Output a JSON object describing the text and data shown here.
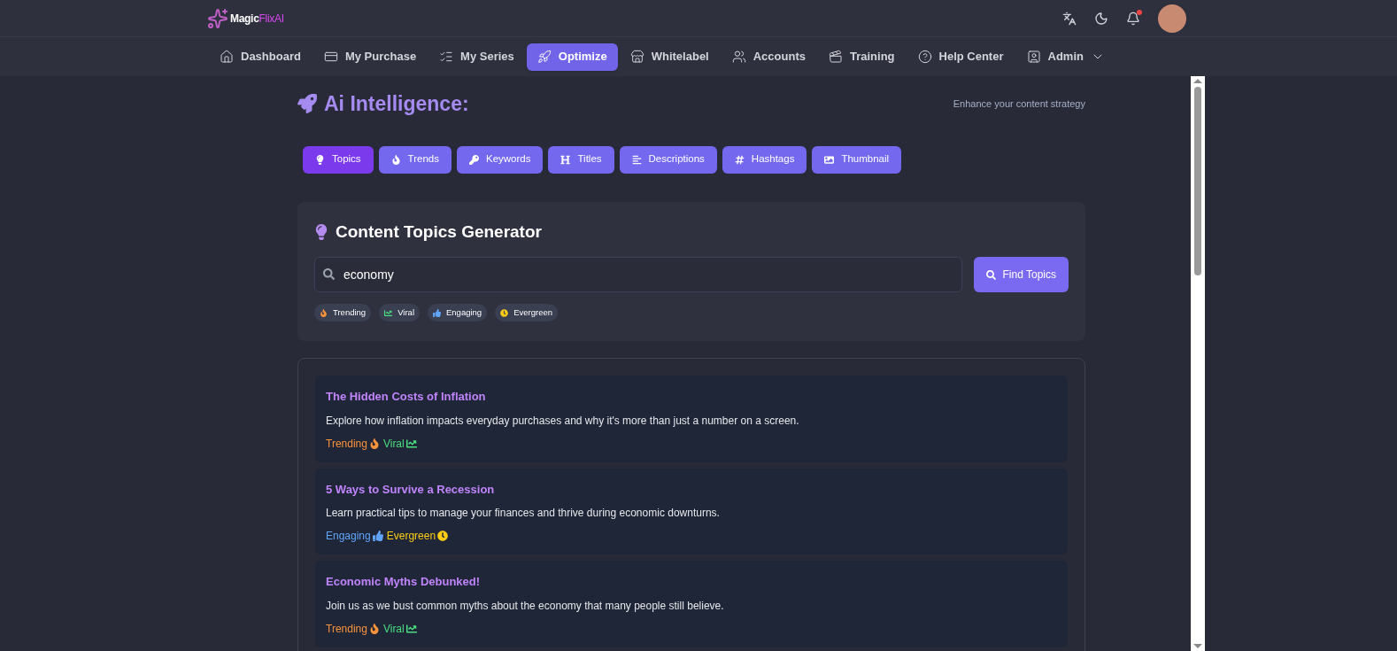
{
  "header": {
    "logo": {
      "brand": "Magic",
      "accent": "FlixAI"
    },
    "notification_dot": true
  },
  "nav": [
    {
      "label": "Dashboard",
      "kind": "home",
      "selected": false
    },
    {
      "label": "My Purchase",
      "kind": "card",
      "selected": false
    },
    {
      "label": "My Series",
      "kind": "list",
      "selected": false
    },
    {
      "label": "Optimize",
      "kind": "rocket",
      "selected": true
    },
    {
      "label": "Whitelabel",
      "kind": "store",
      "selected": false
    },
    {
      "label": "Accounts",
      "kind": "users",
      "selected": false
    },
    {
      "label": "Training",
      "kind": "training",
      "selected": false
    },
    {
      "label": "Help Center",
      "kind": "help",
      "selected": false
    },
    {
      "label": "Admin",
      "kind": "admin",
      "selected": false,
      "dropdown": true
    }
  ],
  "page": {
    "title": "Ai Intelligence:",
    "subtitle": "Enhance your content strategy"
  },
  "tabs": [
    {
      "label": "Topics",
      "kind": "bulb",
      "selected": true
    },
    {
      "label": "Trends",
      "kind": "fire",
      "selected": false
    },
    {
      "label": "Keywords",
      "kind": "key",
      "selected": false
    },
    {
      "label": "Titles",
      "kind": "heading",
      "selected": false
    },
    {
      "label": "Descriptions",
      "kind": "align",
      "selected": false
    },
    {
      "label": "Hashtags",
      "kind": "hash",
      "selected": false
    },
    {
      "label": "Thumbnail",
      "kind": "image",
      "selected": false
    }
  ],
  "generator": {
    "title": "Content Topics Generator",
    "search": {
      "value": "economy"
    },
    "button": "Find Topics",
    "filters": [
      {
        "label": "Trending",
        "kind": "trending"
      },
      {
        "label": "Viral",
        "kind": "viral"
      },
      {
        "label": "Engaging",
        "kind": "engaging"
      },
      {
        "label": "Evergreen",
        "kind": "evergreen"
      }
    ]
  },
  "results": [
    {
      "title": "The Hidden Costs of Inflation",
      "description": "Explore how inflation impacts everyday purchases and why it's more than just a number on a screen.",
      "tags": [
        {
          "label": "Trending",
          "kind": "trending"
        },
        {
          "label": "Viral",
          "kind": "viral"
        }
      ]
    },
    {
      "title": "5 Ways to Survive a Recession",
      "description": "Learn practical tips to manage your finances and thrive during economic downturns.",
      "tags": [
        {
          "label": "Engaging",
          "kind": "engaging"
        },
        {
          "label": "Evergreen",
          "kind": "evergreen"
        }
      ]
    },
    {
      "title": "Economic Myths Debunked!",
      "description": "Join us as we bust common myths about the economy that many people still believe.",
      "tags": [
        {
          "label": "Trending",
          "kind": "trending"
        },
        {
          "label": "Viral",
          "kind": "viral"
        }
      ]
    }
  ]
}
